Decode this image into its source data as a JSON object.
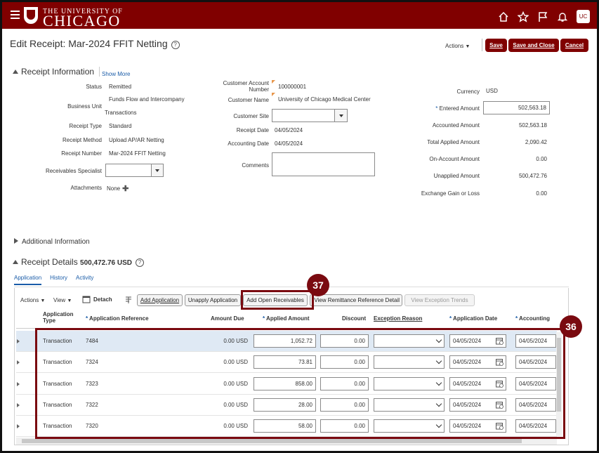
{
  "header": {
    "logo_line1": "THE UNIVERSITY OF",
    "logo_line2": "CHICAGO",
    "user_initials": "UC",
    "brand_color": "#800000"
  },
  "page": {
    "title": "Edit Receipt: Mar-2024 FFIT Netting",
    "actions_label": "Actions",
    "save_label": "Save",
    "save_close_label": "Save and Close",
    "cancel_label": "Cancel"
  },
  "receipt_info": {
    "section_title": "Receipt Information",
    "show_more": "Show More",
    "status_label": "Status",
    "status": "Remitted",
    "business_unit_label": "Business Unit",
    "business_unit_line1": "Funds Flow and Intercompany",
    "business_unit_line2": "Transactions",
    "receipt_type_label": "Receipt Type",
    "receipt_type": "Standard",
    "receipt_method_label": "Receipt Method",
    "receipt_method": "Upload AP/AR Netting",
    "receipt_number_label": "Receipt Number",
    "receipt_number": "Mar-2024 FFIT Netting",
    "specialist_label": "Receivables Specialist",
    "specialist_value": "",
    "attachments_label": "Attachments",
    "attachments_value": "None",
    "cust_acct_label1": "Customer Account",
    "cust_acct_label2": "Number",
    "cust_acct": "100000001",
    "cust_name_label": "Customer Name",
    "cust_name": "University of Chicago Medical Center",
    "cust_site_label": "Customer Site",
    "cust_site": "",
    "receipt_date_label": "Receipt Date",
    "receipt_date": "04/05/2024",
    "accounting_date_label": "Accounting Date",
    "accounting_date": "04/05/2024",
    "comments_label": "Comments",
    "comments": "",
    "currency_label": "Currency",
    "currency": "USD",
    "entered_amount_label": "Entered Amount",
    "entered_amount": "502,563.18",
    "accounted_amount_label": "Accounted Amount",
    "accounted_amount": "502,563.18",
    "total_applied_label": "Total Applied Amount",
    "total_applied": "2,090.42",
    "on_account_label": "On-Account Amount",
    "on_account": "0.00",
    "unapplied_label": "Unapplied Amount",
    "unapplied": "500,472.76",
    "exchange_label": "Exchange Gain or Loss",
    "exchange": "0.00"
  },
  "additional_info": {
    "title": "Additional Information"
  },
  "receipt_details": {
    "title": "Receipt Details",
    "amount": "500,472.76 USD",
    "tabs": [
      "Application",
      "History",
      "Activity"
    ],
    "toolbar": {
      "actions": "Actions",
      "view": "View",
      "detach": "Detach",
      "add_application": "Add Application",
      "unapply_application": "Unapply Application",
      "add_open_receivables": "Add Open Receivables",
      "view_remittance": "View Remittance Reference Detail",
      "view_exception": "View Exception Trends"
    },
    "columns": {
      "app_type1": "Application",
      "app_type2": "Type",
      "app_ref": "Application Reference",
      "amount_due": "Amount Due",
      "applied_amount": "Applied Amount",
      "discount": "Discount",
      "exception_reason": "Exception Reason",
      "app_date": "Application Date",
      "accounting": "Accounting"
    },
    "rows": [
      {
        "type": "Transaction",
        "ref": "7484",
        "amount_due": "0.00 USD",
        "applied": "1,052.72",
        "discount": "0.00",
        "app_date": "04/05/2024",
        "acct_date": "04/05/2024"
      },
      {
        "type": "Transaction",
        "ref": "7324",
        "amount_due": "0.00 USD",
        "applied": "73.81",
        "discount": "0.00",
        "app_date": "04/05/2024",
        "acct_date": "04/05/2024"
      },
      {
        "type": "Transaction",
        "ref": "7323",
        "amount_due": "0.00 USD",
        "applied": "858.00",
        "discount": "0.00",
        "app_date": "04/05/2024",
        "acct_date": "04/05/2024"
      },
      {
        "type": "Transaction",
        "ref": "7322",
        "amount_due": "0.00 USD",
        "applied": "28.00",
        "discount": "0.00",
        "app_date": "04/05/2024",
        "acct_date": "04/05/2024"
      },
      {
        "type": "Transaction",
        "ref": "7320",
        "amount_due": "0.00 USD",
        "applied": "58.00",
        "discount": "0.00",
        "app_date": "04/05/2024",
        "acct_date": "04/05/2024"
      }
    ]
  },
  "annotations": {
    "callout_37": "37",
    "callout_36": "36",
    "color": "#7a0a10"
  }
}
